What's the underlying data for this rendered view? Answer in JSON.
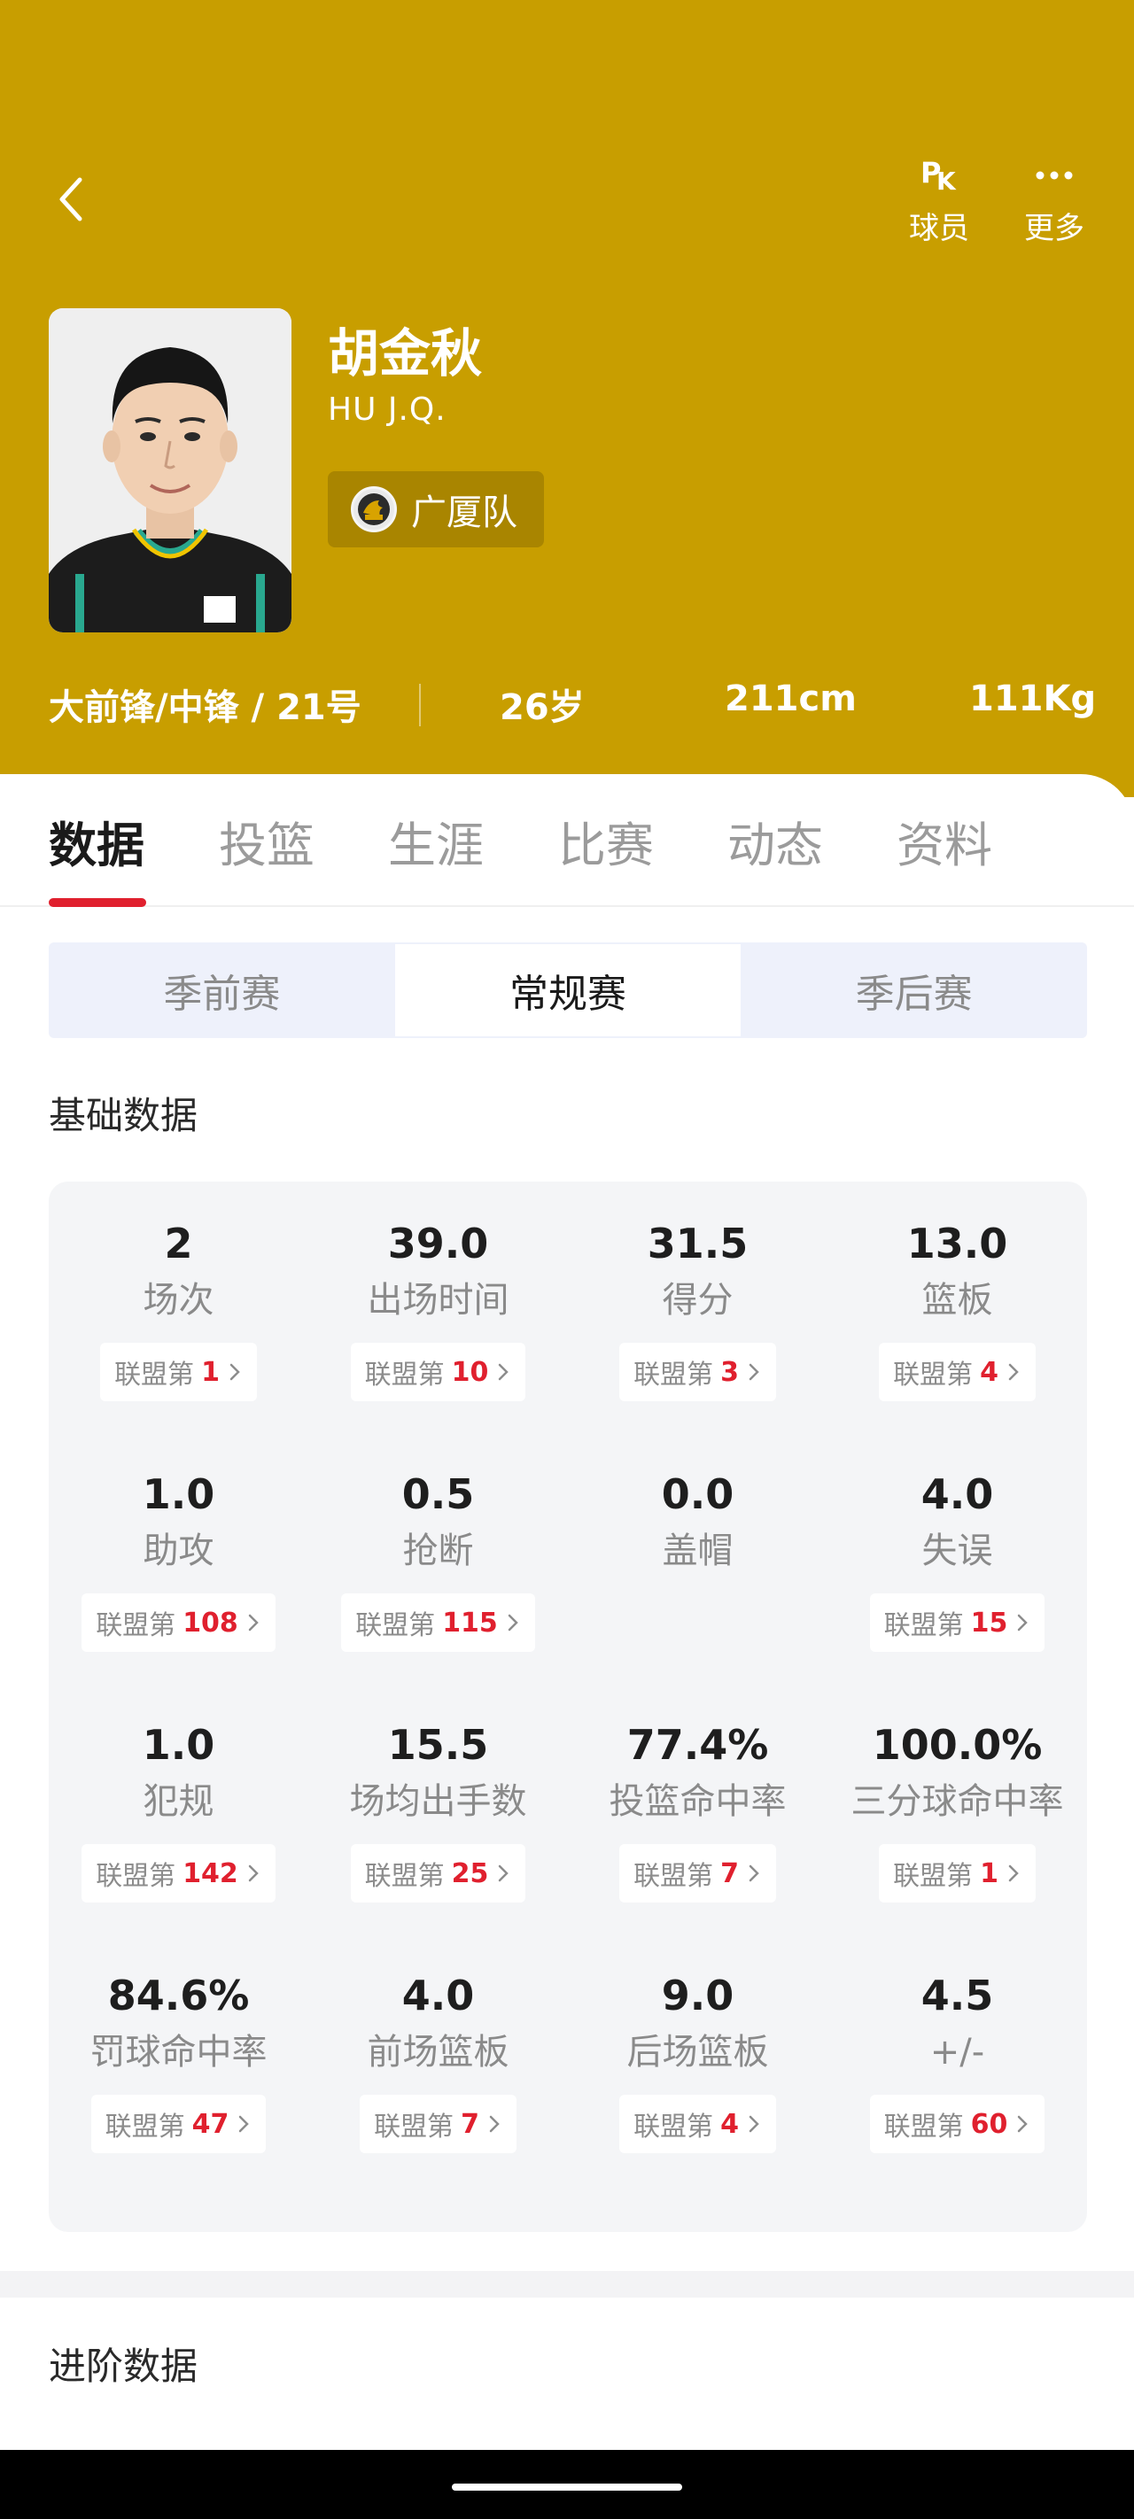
{
  "header": {
    "actions": [
      {
        "icon": "pk-icon",
        "label": "球员"
      },
      {
        "icon": "more-icon",
        "label": "更多"
      }
    ],
    "pk_glyph": {
      "p": "P",
      "k": "K"
    },
    "player": {
      "name": "胡金秋",
      "english_name": "HU J.Q.",
      "team": "广厦队",
      "position_number": "大前锋/中锋 / 21号",
      "age": "26岁",
      "height": "211cm",
      "weight": "111Kg"
    },
    "background_color": "#c89e00"
  },
  "tabs": [
    "数据",
    "投篮",
    "生涯",
    "比赛",
    "动态",
    "资料"
  ],
  "active_tab": "数据",
  "season_types": [
    "季前赛",
    "常规赛",
    "季后赛"
  ],
  "active_season_type": "常规赛",
  "sections": {
    "basic": "基础数据",
    "advanced": "进阶数据"
  },
  "rank_prefix": "联盟第",
  "stats": [
    {
      "value": "2",
      "label": "场次",
      "rank": "1"
    },
    {
      "value": "39.0",
      "label": "出场时间",
      "rank": "10"
    },
    {
      "value": "31.5",
      "label": "得分",
      "rank": "3"
    },
    {
      "value": "13.0",
      "label": "篮板",
      "rank": "4"
    },
    {
      "value": "1.0",
      "label": "助攻",
      "rank": "108"
    },
    {
      "value": "0.5",
      "label": "抢断",
      "rank": "115"
    },
    {
      "value": "0.0",
      "label": "盖帽",
      "rank": null
    },
    {
      "value": "4.0",
      "label": "失误",
      "rank": "15"
    },
    {
      "value": "1.0",
      "label": "犯规",
      "rank": "142"
    },
    {
      "value": "15.5",
      "label": "场均出手数",
      "rank": "25"
    },
    {
      "value": "77.4%",
      "label": "投篮命中率",
      "rank": "7"
    },
    {
      "value": "100.0%",
      "label": "三分球命中率",
      "rank": "1"
    },
    {
      "value": "84.6%",
      "label": "罚球命中率",
      "rank": "47"
    },
    {
      "value": "4.0",
      "label": "前场篮板",
      "rank": "7"
    },
    {
      "value": "9.0",
      "label": "后场篮板",
      "rank": "4"
    },
    {
      "value": "4.5",
      "label": "+/-",
      "rank": "60"
    }
  ],
  "colors": {
    "accent_red": "#e0202e",
    "segment_bg": "#eef1fb"
  }
}
